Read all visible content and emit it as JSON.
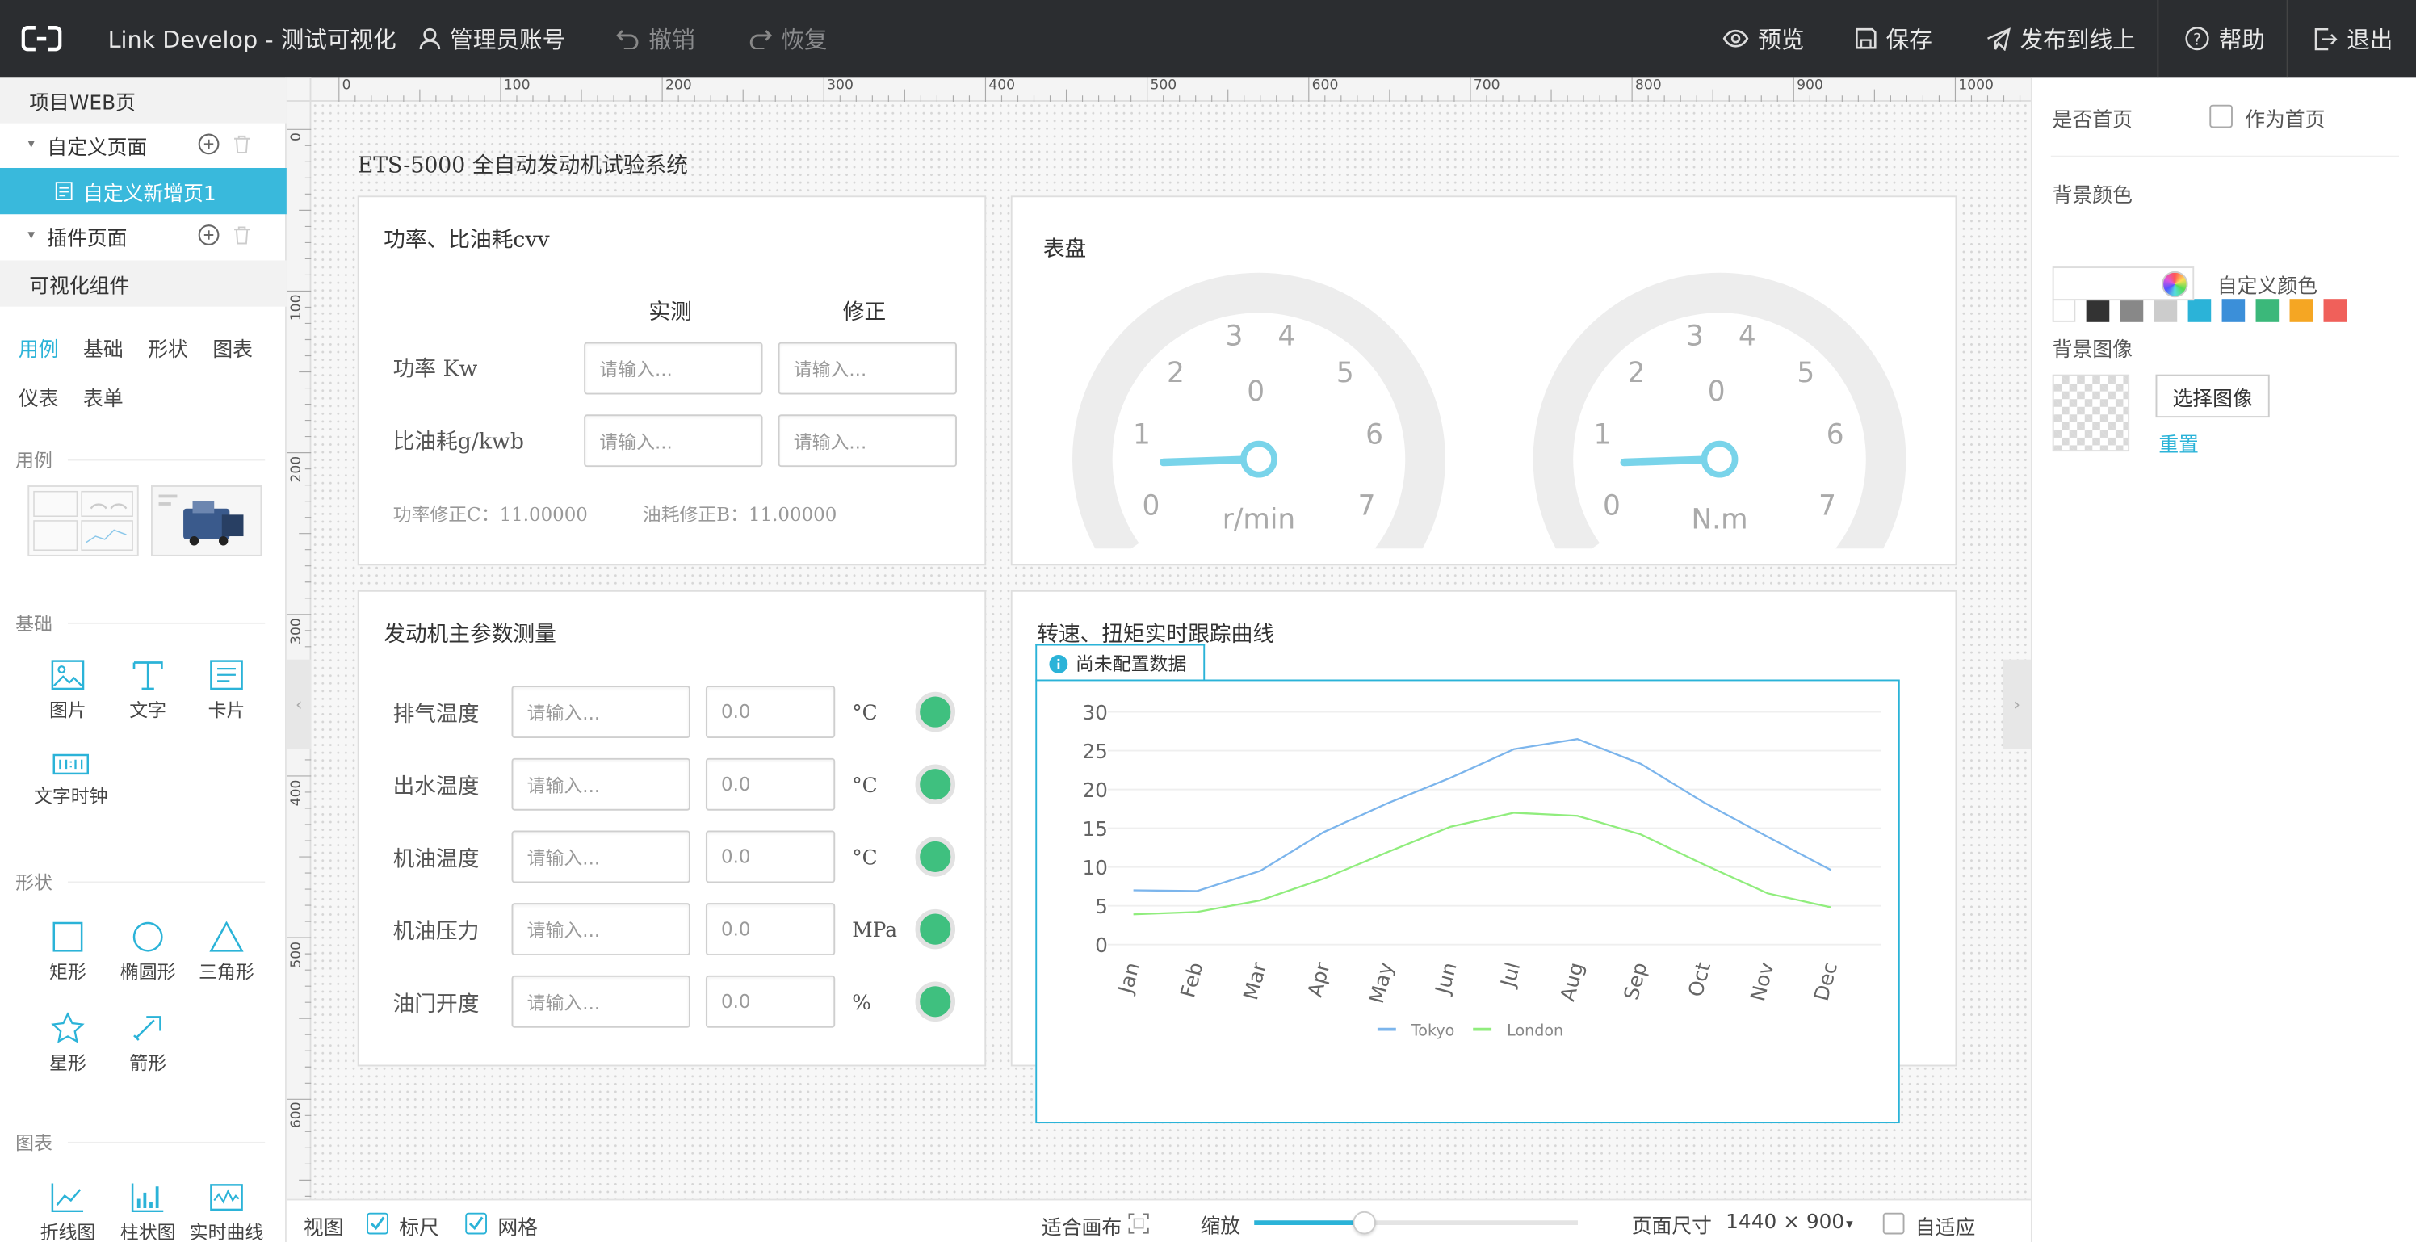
{
  "topbar": {
    "title": "Link Develop - 测试可视化",
    "admin_account": "管理员账号",
    "undo": "撤销",
    "redo": "恢复",
    "preview": "预览",
    "save": "保存",
    "publish": "发布到线上",
    "help": "帮助",
    "logout": "退出"
  },
  "left": {
    "section_web": "项目WEB页",
    "custom_pages": "自定义页面",
    "custom_page_1": "自定义新增页1",
    "plugin_pages": "插件页面",
    "viz_components": "可视化组件",
    "tabs": [
      "用例",
      "基础",
      "形状",
      "图表",
      "仪表",
      "表单"
    ],
    "active_tab": "用例",
    "sections": {
      "examples": "用例",
      "basic": "基础",
      "shapes": "形状",
      "charts": "图表"
    },
    "basic_items": [
      "图片",
      "文字",
      "卡片",
      "文字时钟"
    ],
    "shape_items": [
      "矩形",
      "椭圆形",
      "三角形",
      "星形",
      "箭形"
    ],
    "chart_items": [
      "折线图",
      "柱状图",
      "实时曲线"
    ]
  },
  "ruler": {
    "h": [
      "0",
      "100",
      "200",
      "300",
      "400",
      "500",
      "600",
      "700",
      "800",
      "900",
      "1000"
    ],
    "v": [
      "0",
      "100",
      "200",
      "300",
      "400",
      "500",
      "600"
    ]
  },
  "canvas": {
    "page_title": "ETS-5000 全自动发动机试验系统",
    "power_card": {
      "title": "功率、比油耗cvv",
      "col_measured": "实测",
      "col_corrected": "修正",
      "row_power": "功率 Kw",
      "row_fuel": "比油耗g/kwb",
      "placeholder": "请输入...",
      "note_power": "功率修正C：11.00000",
      "note_fuel": "油耗修正B：11.00000"
    },
    "gauge_card": {
      "title": "表盘",
      "gauges": [
        {
          "unit": "r/min",
          "ticks": [
            "0",
            "1",
            "2",
            "3",
            "4",
            "5",
            "6",
            "7"
          ],
          "center": "0",
          "value": 0.8
        },
        {
          "unit": "N.m",
          "ticks": [
            "0",
            "1",
            "2",
            "3",
            "4",
            "5",
            "6",
            "7"
          ],
          "center": "0",
          "value": 0.8
        }
      ]
    },
    "engine_card": {
      "title": "发动机主参数测量",
      "placeholder": "请输入...",
      "rows": [
        {
          "label": "排气温度",
          "value": "0.0",
          "unit": "°C"
        },
        {
          "label": "出水温度",
          "value": "0.0",
          "unit": "°C"
        },
        {
          "label": "机油温度",
          "value": "0.0",
          "unit": "°C"
        },
        {
          "label": "机油压力",
          "value": "0.0",
          "unit": "MPa"
        },
        {
          "label": "油门开度",
          "value": "0.0",
          "unit": "%"
        }
      ]
    },
    "curve_card": {
      "title": "转速、扭矩实时跟踪曲线",
      "badge": "尚未配置数据"
    }
  },
  "chart_data": {
    "type": "line",
    "title": "",
    "xlabel": "",
    "ylabel": "",
    "categories": [
      "Jan",
      "Feb",
      "Mar",
      "Apr",
      "May",
      "Jun",
      "Jul",
      "Aug",
      "Sep",
      "Oct",
      "Nov",
      "Dec"
    ],
    "ylim": [
      0,
      30
    ],
    "yticks": [
      "0",
      "5",
      "10",
      "15",
      "20",
      "25",
      "30"
    ],
    "grid": true,
    "legend": "bottom",
    "series": [
      {
        "name": "Tokyo",
        "color": "#7cb5ec",
        "values": [
          7.0,
          6.9,
          9.5,
          14.5,
          18.2,
          21.5,
          25.2,
          26.5,
          23.3,
          18.3,
          13.9,
          9.6
        ]
      },
      {
        "name": "London",
        "color": "#90ed7d",
        "values": [
          3.9,
          4.2,
          5.7,
          8.5,
          11.9,
          15.2,
          17.0,
          16.6,
          14.2,
          10.3,
          6.6,
          4.8
        ]
      }
    ]
  },
  "bottom": {
    "view": "视图",
    "ruler": "标尺",
    "grid": "网格",
    "fit_canvas": "适合画布",
    "zoom": "缩放",
    "zoom_level": 0.4,
    "page_size_label": "页面尺寸",
    "page_size": "1440 × 900",
    "adaptive": "自适应"
  },
  "right": {
    "is_home": "是否首页",
    "set_home": "作为首页",
    "bg_color": "背景颜色",
    "swatches": [
      "#ffffff",
      "#333333",
      "#888888",
      "#cccccc",
      "#2bb3d8",
      "#3b8fd9",
      "#3bb87a",
      "#f5a623",
      "#f0605a"
    ],
    "custom_color": "自定义颜色",
    "bg_image": "背景图像",
    "choose_image": "选择图像",
    "reset": "重置"
  },
  "colors": {
    "accent": "#2bb3d8",
    "topbar": "#2b2d30",
    "lamp": "#3fc07f"
  }
}
